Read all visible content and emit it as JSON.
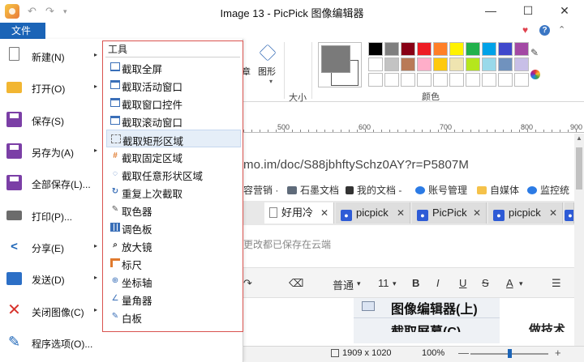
{
  "window": {
    "title": "Image 13 - PicPick 图像编辑器",
    "minimize": "—",
    "maximize": "☐",
    "close": "✕"
  },
  "quick_access": {
    "undo": "↶",
    "redo": "↷",
    "dropdown": "▾"
  },
  "ribbon": {
    "file_tab": "文件",
    "text_label": "章",
    "shape_label": "图形",
    "shape_dropdown": "▾",
    "size_label": "大小",
    "palette_label": "颜色",
    "current_color": "#7a7a7a",
    "swatches": [
      "#000000",
      "#7f7f7f",
      "#880015",
      "#ed1c24",
      "#ff7f27",
      "#fff200",
      "#22b14c",
      "#00a2e8",
      "#3f48cc",
      "#a349a4",
      "#ffffff",
      "#c3c3c3",
      "#b97a57",
      "#ffaec9",
      "#ffc90e",
      "#efe4b0",
      "#b5e61d",
      "#99d9ea",
      "#7092be",
      "#c8bfe7",
      "#ffffff",
      "#ffffff",
      "#ffffff",
      "#ffffff",
      "#ffffff",
      "#ffffff",
      "#ffffff",
      "#ffffff",
      "#ffffff",
      "#ffffff"
    ],
    "icons": [
      "heart-icon",
      "help-icon",
      "ribbon-collapse-icon",
      "eyedropper-icon",
      "color-wheel-icon",
      "shape-icon"
    ]
  },
  "ruler": {
    "ticks": [
      "500",
      "600",
      "700",
      "800",
      "900"
    ]
  },
  "file_menu": {
    "items": [
      {
        "label": "新建(N)",
        "icon": "new-file-icon",
        "has_submenu": true,
        "arrow": "▸"
      },
      {
        "label": "打开(O)",
        "icon": "open-folder-icon",
        "has_submenu": true,
        "arrow": "▸"
      },
      {
        "label": "保存(S)",
        "icon": "save-icon",
        "has_submenu": false,
        "arrow": ""
      },
      {
        "label": "另存为(A)",
        "icon": "save-as-icon",
        "has_submenu": true,
        "arrow": "▸"
      },
      {
        "label": "全部保存(L)...",
        "icon": "save-all-icon",
        "has_submenu": false,
        "arrow": ""
      },
      {
        "label": "打印(P)...",
        "icon": "print-icon",
        "has_submenu": false,
        "arrow": ""
      },
      {
        "label": "分享(E)",
        "icon": "share-icon",
        "has_submenu": true,
        "arrow": "▸"
      },
      {
        "label": "发送(D)",
        "icon": "send-icon",
        "has_submenu": true,
        "arrow": "▸"
      },
      {
        "label": "关闭图像(C)",
        "icon": "close-image-icon",
        "has_submenu": true,
        "arrow": "▸"
      },
      {
        "label": "程序选项(O)...",
        "icon": "options-icon",
        "has_submenu": false,
        "arrow": ""
      }
    ]
  },
  "tools_menu": {
    "header": "工具",
    "highlighted_index": 4,
    "items": [
      {
        "label": "截取全屏",
        "icon": "fullscreen-capture-icon"
      },
      {
        "label": "截取活动窗口",
        "icon": "active-window-icon"
      },
      {
        "label": "截取窗口控件",
        "icon": "window-control-icon"
      },
      {
        "label": "截取滚动窗口",
        "icon": "scroll-window-icon"
      },
      {
        "label": "截取矩形区域",
        "icon": "rect-region-icon"
      },
      {
        "label": "截取固定区域",
        "icon": "fixed-region-icon"
      },
      {
        "label": "截取任意形状区域",
        "icon": "freehand-region-icon"
      },
      {
        "label": "重复上次截取",
        "icon": "repeat-capture-icon"
      },
      {
        "label": "取色器",
        "icon": "color-picker-icon"
      },
      {
        "label": "调色板",
        "icon": "palette-icon"
      },
      {
        "label": "放大镜",
        "icon": "magnifier-icon"
      },
      {
        "label": "标尺",
        "icon": "ruler-icon"
      },
      {
        "label": "坐标轴",
        "icon": "crosshair-icon"
      },
      {
        "label": "量角器",
        "icon": "protractor-icon"
      },
      {
        "label": "白板",
        "icon": "whiteboard-icon"
      }
    ]
  },
  "canvas": {
    "url": "mo.im/doc/S88jbhftySchz0AY?r=P5807M",
    "bookmarks": [
      "容营销 ·",
      "石墨文档",
      "我的文档 -",
      "账号管理",
      "自媒体",
      "监控统"
    ],
    "tabs": [
      {
        "label": "好用冷",
        "active": true,
        "close": "✕"
      },
      {
        "label": "picpick",
        "active": false,
        "close": "✕"
      },
      {
        "label": "PicPick",
        "active": false,
        "close": "✕"
      },
      {
        "label": "picpick",
        "active": false,
        "close": "✕"
      }
    ],
    "notice": "更改都已保存在云端",
    "editor_toolbar": {
      "style": "普通",
      "style_dropdown": "▾",
      "size": "11",
      "size_dropdown": "▾",
      "bold": "B",
      "italic": "I",
      "underline": "U",
      "strike": "S",
      "font_color": "A",
      "font_color_dropdown": "▾",
      "list": "☰"
    },
    "doc_heading": "图像编辑器(上)",
    "doc_cut_text": "截取屏幕(C)",
    "doc_right_text": "做技术"
  },
  "status": {
    "image_size": "1909 x 1020",
    "zoom": "100%",
    "zoom_level": 0.5,
    "minus": "—",
    "plus": "+"
  }
}
